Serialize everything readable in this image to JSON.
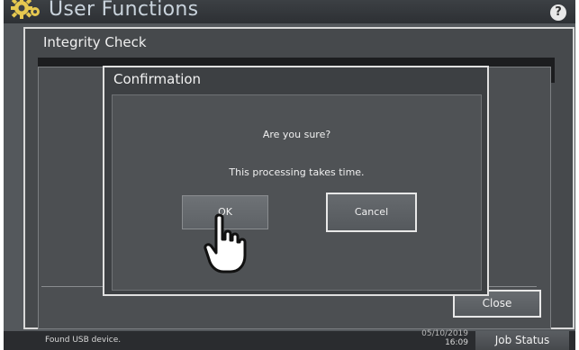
{
  "header": {
    "title": "User Functions",
    "help_label": "?"
  },
  "panel": {
    "title": "Integrity Check",
    "close_label": "Close"
  },
  "dialog": {
    "title": "Confirmation",
    "message_primary": "Are you sure?",
    "message_secondary": "This processing takes time.",
    "ok_label": "OK",
    "cancel_label": "Cancel"
  },
  "status": {
    "message": "Found USB device.",
    "date": "05/10/2019",
    "time": "16:09",
    "job_status_label": "Job Status"
  },
  "icons": {
    "settings": "gear-icon",
    "help": "help-icon",
    "pointer": "hand-pointer-icon"
  }
}
